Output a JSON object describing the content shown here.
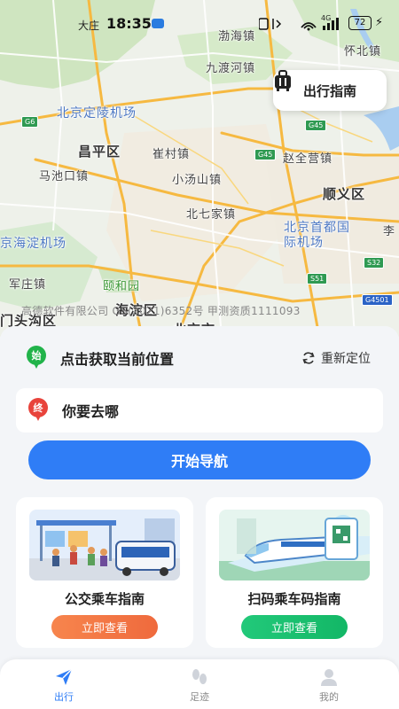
{
  "status_bar": {
    "time": "18:35",
    "carrier_prefix": "大庄",
    "battery": "72",
    "network": "4G"
  },
  "map": {
    "labels": {
      "bohaizhen": "渤海镇",
      "huairounan": "怀北镇",
      "jiuduhe": "九渡河镇",
      "dingling": "北京定陵机场",
      "changping": "昌平区",
      "cuicun": "崔村镇",
      "zhaoquanying": "赵全营镇",
      "machikou": "马池口镇",
      "xiaotangshan": "小汤山镇",
      "shunyi": "顺义区",
      "beiqijia": "北七家镇",
      "capital_airport": "北京首都国际机场",
      "haidian_airport": "京海淀机场",
      "li": "李",
      "wenquan": "军庄镇",
      "yiheyuan": "颐和园",
      "haidian": "海淀区",
      "mentougou": "门头沟区",
      "beijing": "北京市"
    },
    "roads": [
      "G6",
      "G45",
      "G45",
      "S32",
      "S51",
      "G4501"
    ],
    "watermark": "高德软件有限公司 GS(2021)6352号 甲测资质1111093"
  },
  "guide_button": {
    "label": "出行指南",
    "icon": "luggage-icon"
  },
  "location": {
    "start_badge": "始",
    "start_text": "点击获取当前位置",
    "relocate": "重新定位",
    "end_badge": "终",
    "destination_placeholder": "你要去哪"
  },
  "navigate_button": "开始导航",
  "cards": [
    {
      "title": "公交乘车指南",
      "button": "立即查看"
    },
    {
      "title": "扫码乘车码指南",
      "button": "立即查看"
    }
  ],
  "bottom_nav": {
    "tabs": [
      {
        "label": "出行",
        "icon": "send-icon",
        "active": true
      },
      {
        "label": "足迹",
        "icon": "footprint-icon",
        "active": false
      },
      {
        "label": "我的",
        "icon": "user-icon",
        "active": false
      }
    ]
  },
  "colors": {
    "primary": "#2f7df6",
    "start_green": "#21b34a",
    "end_red": "#e8433b",
    "pill_orange": "#f3733f",
    "pill_green": "#19c26f"
  }
}
